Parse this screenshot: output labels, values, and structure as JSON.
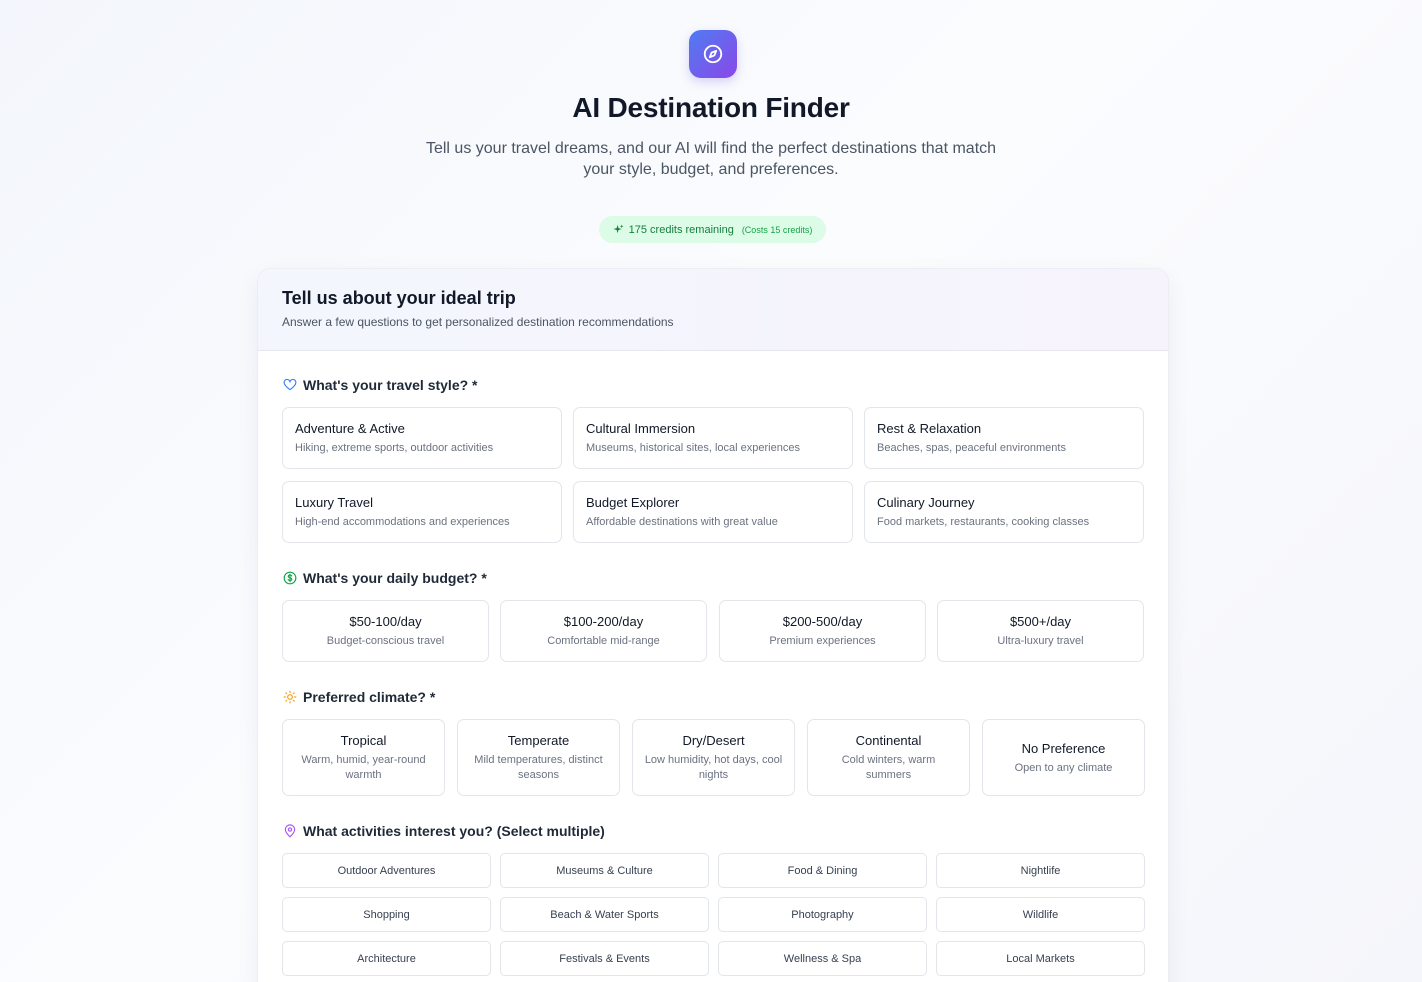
{
  "header": {
    "logo_icon": "compass-icon",
    "title": "AI Destination Finder",
    "subtitle": "Tell us your travel dreams, and our AI will find the perfect destinations that match your style, budget, and preferences.",
    "credits_text": "175 credits remaining",
    "credits_cost": "(Costs 15 credits)",
    "credits_icon": "sparkles-icon"
  },
  "form": {
    "title": "Tell us about your ideal trip",
    "subtitle": "Answer a few questions to get personalized destination recommendations",
    "travel_style": {
      "label": "What's your travel style? *",
      "icon": "heart-icon",
      "options": [
        {
          "title": "Adventure & Active",
          "desc": "Hiking, extreme sports, outdoor activities"
        },
        {
          "title": "Cultural Immersion",
          "desc": "Museums, historical sites, local experiences"
        },
        {
          "title": "Rest & Relaxation",
          "desc": "Beaches, spas, peaceful environments"
        },
        {
          "title": "Luxury Travel",
          "desc": "High-end accommodations and experiences"
        },
        {
          "title": "Budget Explorer",
          "desc": "Affordable destinations with great value"
        },
        {
          "title": "Culinary Journey",
          "desc": "Food markets, restaurants, cooking classes"
        }
      ]
    },
    "budget": {
      "label": "What's your daily budget? *",
      "icon": "dollar-icon",
      "options": [
        {
          "title": "$50-100/day",
          "desc": "Budget-conscious travel"
        },
        {
          "title": "$100-200/day",
          "desc": "Comfortable mid-range"
        },
        {
          "title": "$200-500/day",
          "desc": "Premium experiences"
        },
        {
          "title": "$500+/day",
          "desc": "Ultra-luxury travel"
        }
      ]
    },
    "climate": {
      "label": "Preferred climate? *",
      "icon": "sun-icon",
      "options": [
        {
          "title": "Tropical",
          "desc": "Warm, humid, year-round warmth"
        },
        {
          "title": "Temperate",
          "desc": "Mild temperatures, distinct seasons"
        },
        {
          "title": "Dry/Desert",
          "desc": "Low humidity, hot days, cool nights"
        },
        {
          "title": "Continental",
          "desc": "Cold winters, warm summers"
        },
        {
          "title": "No Preference",
          "desc": "Open to any climate"
        }
      ]
    },
    "activities": {
      "label": "What activities interest you? (Select multiple)",
      "icon": "map-pin-icon",
      "options": [
        "Outdoor Adventures",
        "Museums & Culture",
        "Food & Dining",
        "Nightlife",
        "Shopping",
        "Beach & Water Sports",
        "Photography",
        "Wildlife",
        "Architecture",
        "Festivals & Events",
        "Wellness & Spa",
        "Local Markets"
      ]
    }
  },
  "colors": {
    "accent_start": "#4f7cf2",
    "accent_end": "#8b47e8",
    "credits_bg": "#dcfce7",
    "credits_text": "#15803d"
  }
}
